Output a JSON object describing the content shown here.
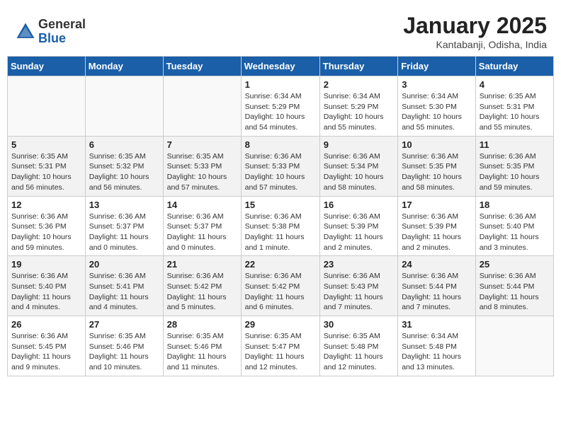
{
  "header": {
    "logo_general": "General",
    "logo_blue": "Blue",
    "month_title": "January 2025",
    "location": "Kantabanji, Odisha, India"
  },
  "days_of_week": [
    "Sunday",
    "Monday",
    "Tuesday",
    "Wednesday",
    "Thursday",
    "Friday",
    "Saturday"
  ],
  "weeks": [
    [
      {
        "day": "",
        "info": ""
      },
      {
        "day": "",
        "info": ""
      },
      {
        "day": "",
        "info": ""
      },
      {
        "day": "1",
        "info": "Sunrise: 6:34 AM\nSunset: 5:29 PM\nDaylight: 10 hours\nand 54 minutes."
      },
      {
        "day": "2",
        "info": "Sunrise: 6:34 AM\nSunset: 5:29 PM\nDaylight: 10 hours\nand 55 minutes."
      },
      {
        "day": "3",
        "info": "Sunrise: 6:34 AM\nSunset: 5:30 PM\nDaylight: 10 hours\nand 55 minutes."
      },
      {
        "day": "4",
        "info": "Sunrise: 6:35 AM\nSunset: 5:31 PM\nDaylight: 10 hours\nand 55 minutes."
      }
    ],
    [
      {
        "day": "5",
        "info": "Sunrise: 6:35 AM\nSunset: 5:31 PM\nDaylight: 10 hours\nand 56 minutes."
      },
      {
        "day": "6",
        "info": "Sunrise: 6:35 AM\nSunset: 5:32 PM\nDaylight: 10 hours\nand 56 minutes."
      },
      {
        "day": "7",
        "info": "Sunrise: 6:35 AM\nSunset: 5:33 PM\nDaylight: 10 hours\nand 57 minutes."
      },
      {
        "day": "8",
        "info": "Sunrise: 6:36 AM\nSunset: 5:33 PM\nDaylight: 10 hours\nand 57 minutes."
      },
      {
        "day": "9",
        "info": "Sunrise: 6:36 AM\nSunset: 5:34 PM\nDaylight: 10 hours\nand 58 minutes."
      },
      {
        "day": "10",
        "info": "Sunrise: 6:36 AM\nSunset: 5:35 PM\nDaylight: 10 hours\nand 58 minutes."
      },
      {
        "day": "11",
        "info": "Sunrise: 6:36 AM\nSunset: 5:35 PM\nDaylight: 10 hours\nand 59 minutes."
      }
    ],
    [
      {
        "day": "12",
        "info": "Sunrise: 6:36 AM\nSunset: 5:36 PM\nDaylight: 10 hours\nand 59 minutes."
      },
      {
        "day": "13",
        "info": "Sunrise: 6:36 AM\nSunset: 5:37 PM\nDaylight: 11 hours\nand 0 minutes."
      },
      {
        "day": "14",
        "info": "Sunrise: 6:36 AM\nSunset: 5:37 PM\nDaylight: 11 hours\nand 0 minutes."
      },
      {
        "day": "15",
        "info": "Sunrise: 6:36 AM\nSunset: 5:38 PM\nDaylight: 11 hours\nand 1 minute."
      },
      {
        "day": "16",
        "info": "Sunrise: 6:36 AM\nSunset: 5:39 PM\nDaylight: 11 hours\nand 2 minutes."
      },
      {
        "day": "17",
        "info": "Sunrise: 6:36 AM\nSunset: 5:39 PM\nDaylight: 11 hours\nand 2 minutes."
      },
      {
        "day": "18",
        "info": "Sunrise: 6:36 AM\nSunset: 5:40 PM\nDaylight: 11 hours\nand 3 minutes."
      }
    ],
    [
      {
        "day": "19",
        "info": "Sunrise: 6:36 AM\nSunset: 5:40 PM\nDaylight: 11 hours\nand 4 minutes."
      },
      {
        "day": "20",
        "info": "Sunrise: 6:36 AM\nSunset: 5:41 PM\nDaylight: 11 hours\nand 4 minutes."
      },
      {
        "day": "21",
        "info": "Sunrise: 6:36 AM\nSunset: 5:42 PM\nDaylight: 11 hours\nand 5 minutes."
      },
      {
        "day": "22",
        "info": "Sunrise: 6:36 AM\nSunset: 5:42 PM\nDaylight: 11 hours\nand 6 minutes."
      },
      {
        "day": "23",
        "info": "Sunrise: 6:36 AM\nSunset: 5:43 PM\nDaylight: 11 hours\nand 7 minutes."
      },
      {
        "day": "24",
        "info": "Sunrise: 6:36 AM\nSunset: 5:44 PM\nDaylight: 11 hours\nand 7 minutes."
      },
      {
        "day": "25",
        "info": "Sunrise: 6:36 AM\nSunset: 5:44 PM\nDaylight: 11 hours\nand 8 minutes."
      }
    ],
    [
      {
        "day": "26",
        "info": "Sunrise: 6:36 AM\nSunset: 5:45 PM\nDaylight: 11 hours\nand 9 minutes."
      },
      {
        "day": "27",
        "info": "Sunrise: 6:35 AM\nSunset: 5:46 PM\nDaylight: 11 hours\nand 10 minutes."
      },
      {
        "day": "28",
        "info": "Sunrise: 6:35 AM\nSunset: 5:46 PM\nDaylight: 11 hours\nand 11 minutes."
      },
      {
        "day": "29",
        "info": "Sunrise: 6:35 AM\nSunset: 5:47 PM\nDaylight: 11 hours\nand 12 minutes."
      },
      {
        "day": "30",
        "info": "Sunrise: 6:35 AM\nSunset: 5:48 PM\nDaylight: 11 hours\nand 12 minutes."
      },
      {
        "day": "31",
        "info": "Sunrise: 6:34 AM\nSunset: 5:48 PM\nDaylight: 11 hours\nand 13 minutes."
      },
      {
        "day": "",
        "info": ""
      }
    ]
  ]
}
